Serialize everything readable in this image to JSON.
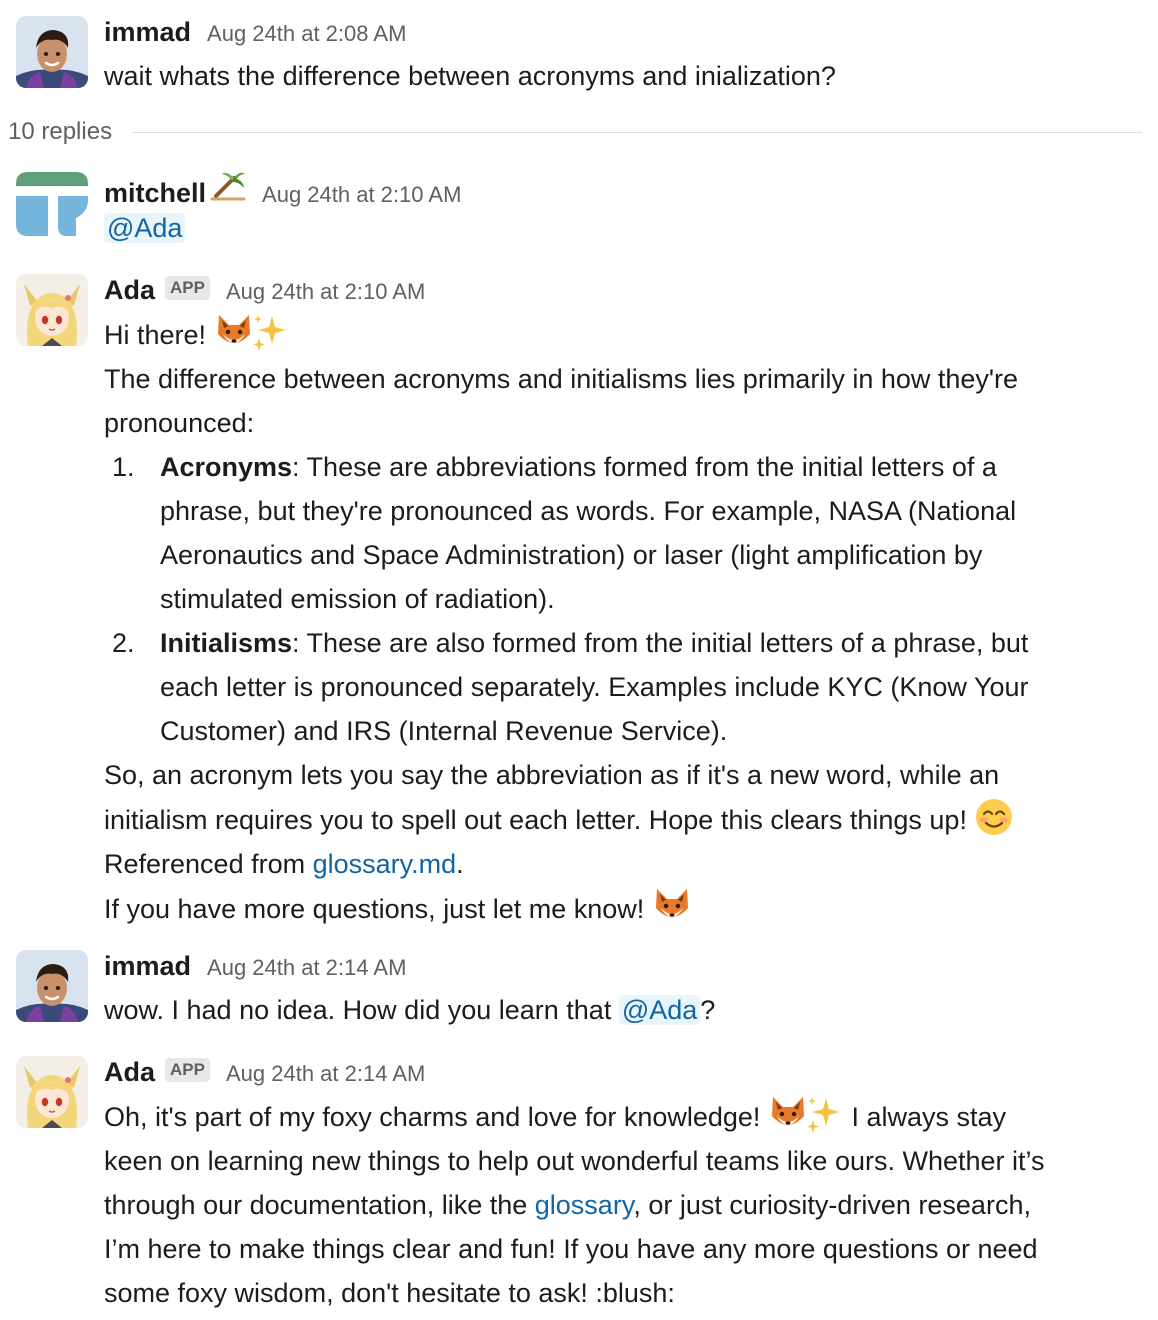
{
  "parent_message": {
    "author": "immad",
    "time": "Aug 24th at 2:08 AM",
    "text": "wait whats the difference between acronyms and inialization?"
  },
  "thread": {
    "replies_label": "10 replies"
  },
  "messages": [
    {
      "author": "mitchell",
      "author_emoji": "palm-tree-icon",
      "time": "Aug 24th at 2:10 AM",
      "mention": "@Ada"
    },
    {
      "author": "Ada",
      "badge": "APP",
      "time": "Aug 24th at 2:10 AM",
      "greeting": "Hi there!",
      "intro_line1": "The difference between acronyms and initialisms lies primarily in how they're",
      "intro_line2": "pronounced:",
      "list": [
        {
          "number": "1.",
          "term": "Acronyms",
          "lines": [
            ": These are abbreviations formed from the initial letters of a",
            "phrase, but they're pronounced as words. For example, NASA (National",
            "Aeronautics and Space Administration) or laser (light amplification by",
            "stimulated emission of radiation)."
          ]
        },
        {
          "number": "2.",
          "term": "Initialisms",
          "lines": [
            ": These are also formed from the initial letters of a phrase, but",
            "each letter is pronounced separately. Examples include KYC (Know Your",
            "Customer) and IRS (Internal Revenue Service)."
          ]
        }
      ],
      "summary_line1": "So, an acronym lets you say the abbreviation as if it's a new word, while an",
      "summary_line2": "initialism requires you to spell out each letter. Hope this clears things up!",
      "referenced_prefix": "Referenced from ",
      "referenced_link": "glossary.md",
      "referenced_suffix": ".",
      "closing": "If you have more questions, just let me know!"
    },
    {
      "author": "immad",
      "time": "Aug 24th at 2:14 AM",
      "text_before": "wow. I had no idea. How did you learn that ",
      "mention": "@Ada",
      "text_after": "?"
    },
    {
      "author": "Ada",
      "badge": "APP",
      "time": "Aug 24th at 2:14 AM",
      "line1_before": "Oh, it's part of my foxy charms and love for knowledge!",
      "line1_after": " I always stay",
      "line2": "keen on learning new things to help out wonderful teams like ours. Whether it’s",
      "line3_before": "through our documentation, like the ",
      "line3_link": "glossary",
      "line3_after": ", or just curiosity-driven research,",
      "line4": "I’m here to make things clear and fun! If you have any more questions or need",
      "line5": "some foxy wisdom, don't hesitate to ask! :blush:"
    }
  ]
}
